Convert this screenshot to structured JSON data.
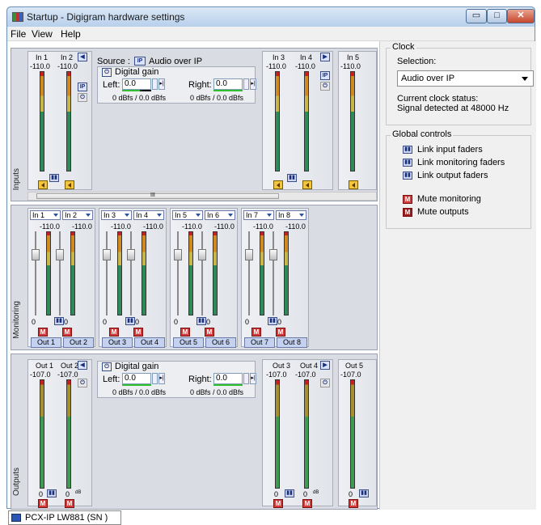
{
  "window": {
    "title": "Startup - Digigram hardware settings",
    "minimize": "▭",
    "maximize": "□",
    "close": "✕"
  },
  "menu": [
    "File",
    "View",
    "Help"
  ],
  "inputs": {
    "section_label": "Inputs",
    "strips": [
      {
        "ch1": "In 1",
        "ch2": "In 2",
        "v1": "-110.0",
        "v2": "-110.0"
      },
      {
        "ch1": "In 3",
        "ch2": "In 4",
        "v1": "-110.0",
        "v2": "-110.0"
      },
      {
        "ch1": "In 5",
        "v1": "-110.0"
      }
    ],
    "source_label": "Source :",
    "source_icon": "IP",
    "source_value": "Audio over IP",
    "gain_title": "Digital gain",
    "left_label": "Left:",
    "left_value": "0.0",
    "right_label": "Right:",
    "right_value": "0.0",
    "left_dbfs": "0 dBfs / 0.0 dBfs",
    "right_dbfs": "0 dBfs / 0.0 dBfs",
    "scroll_mark": "III"
  },
  "monitoring": {
    "section_label": "Monitoring",
    "groups": [
      {
        "a": "In 1",
        "b": "In 2",
        "va": "-110.0",
        "vb": "-110.0",
        "za": "0",
        "zb": "0",
        "oa": "Out 1",
        "ob": "Out 2"
      },
      {
        "a": "In 3",
        "b": "In 4",
        "va": "-110.0",
        "vb": "-110.0",
        "za": "0",
        "zb": "0",
        "oa": "Out 3",
        "ob": "Out 4"
      },
      {
        "a": "In 5",
        "b": "In 6",
        "va": "-110.0",
        "vb": "-110.0",
        "za": "0",
        "zb": "0",
        "oa": "Out 5",
        "ob": "Out 6"
      },
      {
        "a": "In 7",
        "b": "In 8",
        "va": "-110.0",
        "vb": "-110.0",
        "za": "0",
        "zb": "0",
        "oa": "Out 7",
        "ob": "Out 8"
      }
    ],
    "mute_letter": "M"
  },
  "outputs": {
    "section_label": "Outputs",
    "strips": [
      {
        "ch1": "Out 1",
        "ch2": "Out 2",
        "v1": "-107.0",
        "v2": "-107.0"
      },
      {
        "ch1": "Out 3",
        "ch2": "Out 4",
        "v1": "-107.0",
        "v2": "-107.0"
      },
      {
        "ch1": "Out 5",
        "v1": "-107.0"
      }
    ],
    "zero": "0",
    "db_mark": "dB",
    "gain_title": "Digital gain",
    "left_label": "Left:",
    "left_value": "0.0",
    "right_label": "Right:",
    "right_value": "0.0",
    "left_dbfs": "0 dBfs / 0.0 dBfs",
    "right_dbfs": "0 dBfs / 0.0 dBfs"
  },
  "clock": {
    "title": "Clock",
    "selection_label": "Selection:",
    "selection_value": "Audio over IP",
    "status_label": "Current clock status:",
    "status_value": "Signal detected at 48000 Hz"
  },
  "global": {
    "title": "Global controls",
    "link_input": "Link input faders",
    "link_monitoring": "Link monitoring faders",
    "link_output": "Link output faders",
    "mute_monitoring": "Mute monitoring",
    "mute_outputs": "Mute outputs",
    "mute_letter": "M"
  },
  "status": {
    "device": "PCX-IP LW881 (SN )"
  },
  "colors": {
    "panel": "#d9dce3",
    "mute": "#d23a3a",
    "gain_bar": "#2fbf2f",
    "accent": "#2b4fa0"
  }
}
